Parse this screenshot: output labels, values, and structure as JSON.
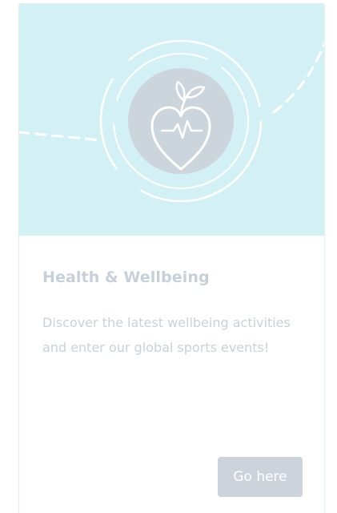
{
  "card": {
    "icon": "heart-apple-pulse-icon",
    "title": "Health & Wellbeing",
    "description": "Discover the latest wellbeing activities and enter our global sports events!",
    "button_label": "Go here"
  },
  "colors": {
    "hero_background": "#d3f1f5",
    "icon_circle": "#ccd4dc",
    "title_text": "#c7cfd8",
    "body_text": "#c9d1d9",
    "button_background": "#cdd3da",
    "button_text": "#ffffff"
  }
}
